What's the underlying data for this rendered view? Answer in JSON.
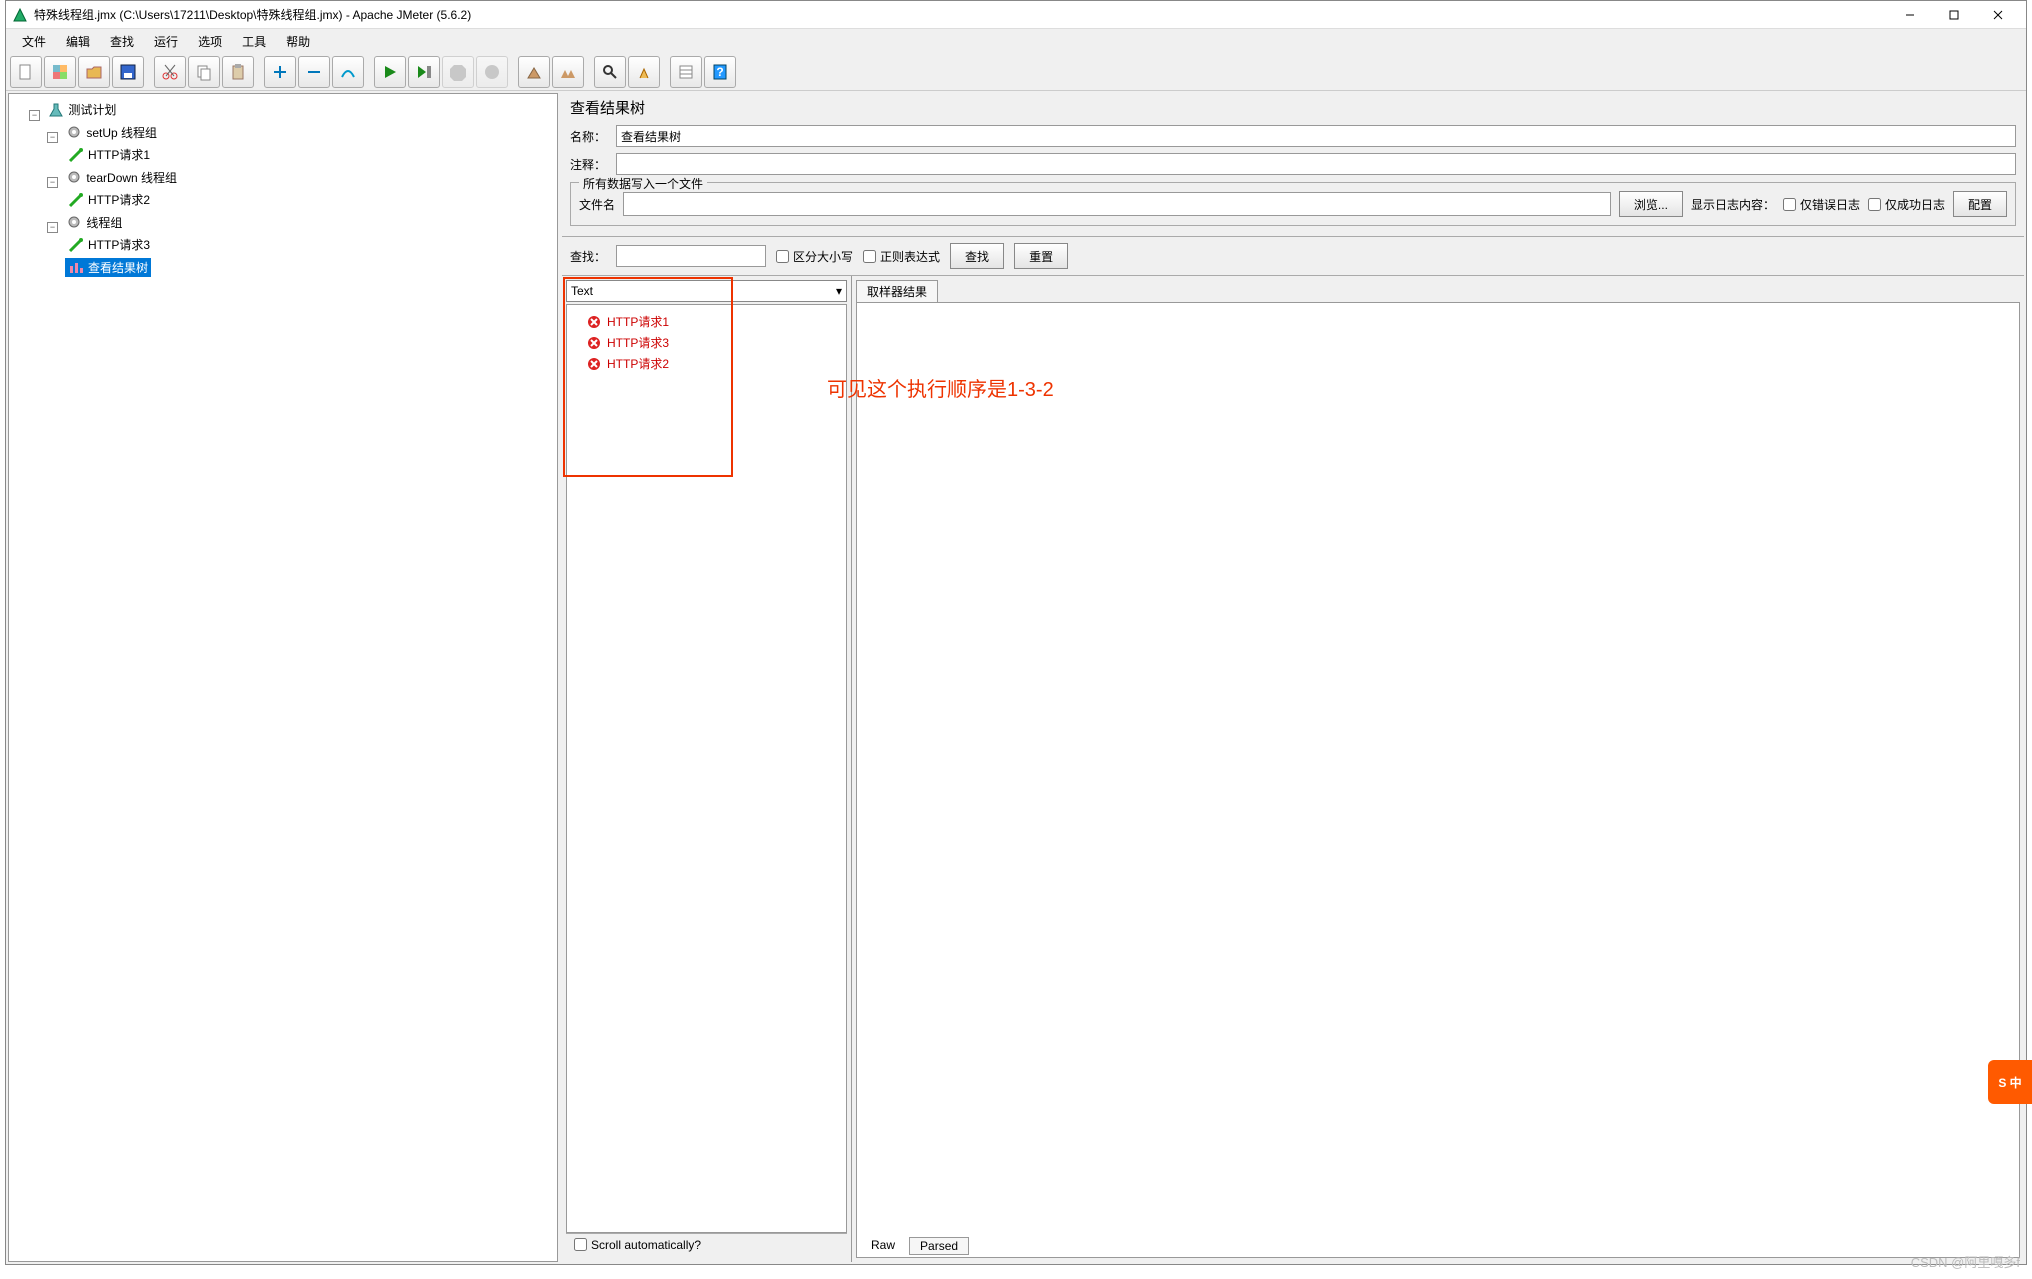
{
  "window": {
    "title": "特殊线程组.jmx (C:\\Users\\17211\\Desktop\\特殊线程组.jmx) - Apache JMeter (5.6.2)"
  },
  "menu": [
    "文件",
    "编辑",
    "查找",
    "运行",
    "选项",
    "工具",
    "帮助"
  ],
  "tree": {
    "root": "测试计划",
    "groups": [
      {
        "name": "setUp 线程组",
        "items": [
          "HTTP请求1"
        ]
      },
      {
        "name": "tearDown 线程组",
        "items": [
          "HTTP请求2"
        ]
      },
      {
        "name": "线程组",
        "items": [
          "HTTP请求3",
          "查看结果树"
        ]
      }
    ]
  },
  "panel": {
    "title": "查看结果树",
    "name_label": "名称：",
    "name_value": "查看结果树",
    "comment_label": "注释：",
    "comment_value": "",
    "file_legend": "所有数据写入一个文件",
    "file_label": "文件名",
    "browse": "浏览...",
    "log_label": "显示日志内容：",
    "err_only": "仅错误日志",
    "ok_only": "仅成功日志",
    "config": "配置"
  },
  "search": {
    "label": "查找：",
    "case": "区分大小写",
    "regex": "正则表达式",
    "find": "查找",
    "reset": "重置"
  },
  "results": {
    "renderer": "Text",
    "samples": [
      "HTTP请求1",
      "HTTP请求3",
      "HTTP请求2"
    ],
    "sampler_tab": "取样器结果",
    "scroll": "Scroll automatically?",
    "raw": "Raw",
    "parsed": "Parsed"
  },
  "annotation": "可见这个执行顺序是1-3-2",
  "watermark": "CSDN @阿里嘎多f",
  "ime": "S  中"
}
